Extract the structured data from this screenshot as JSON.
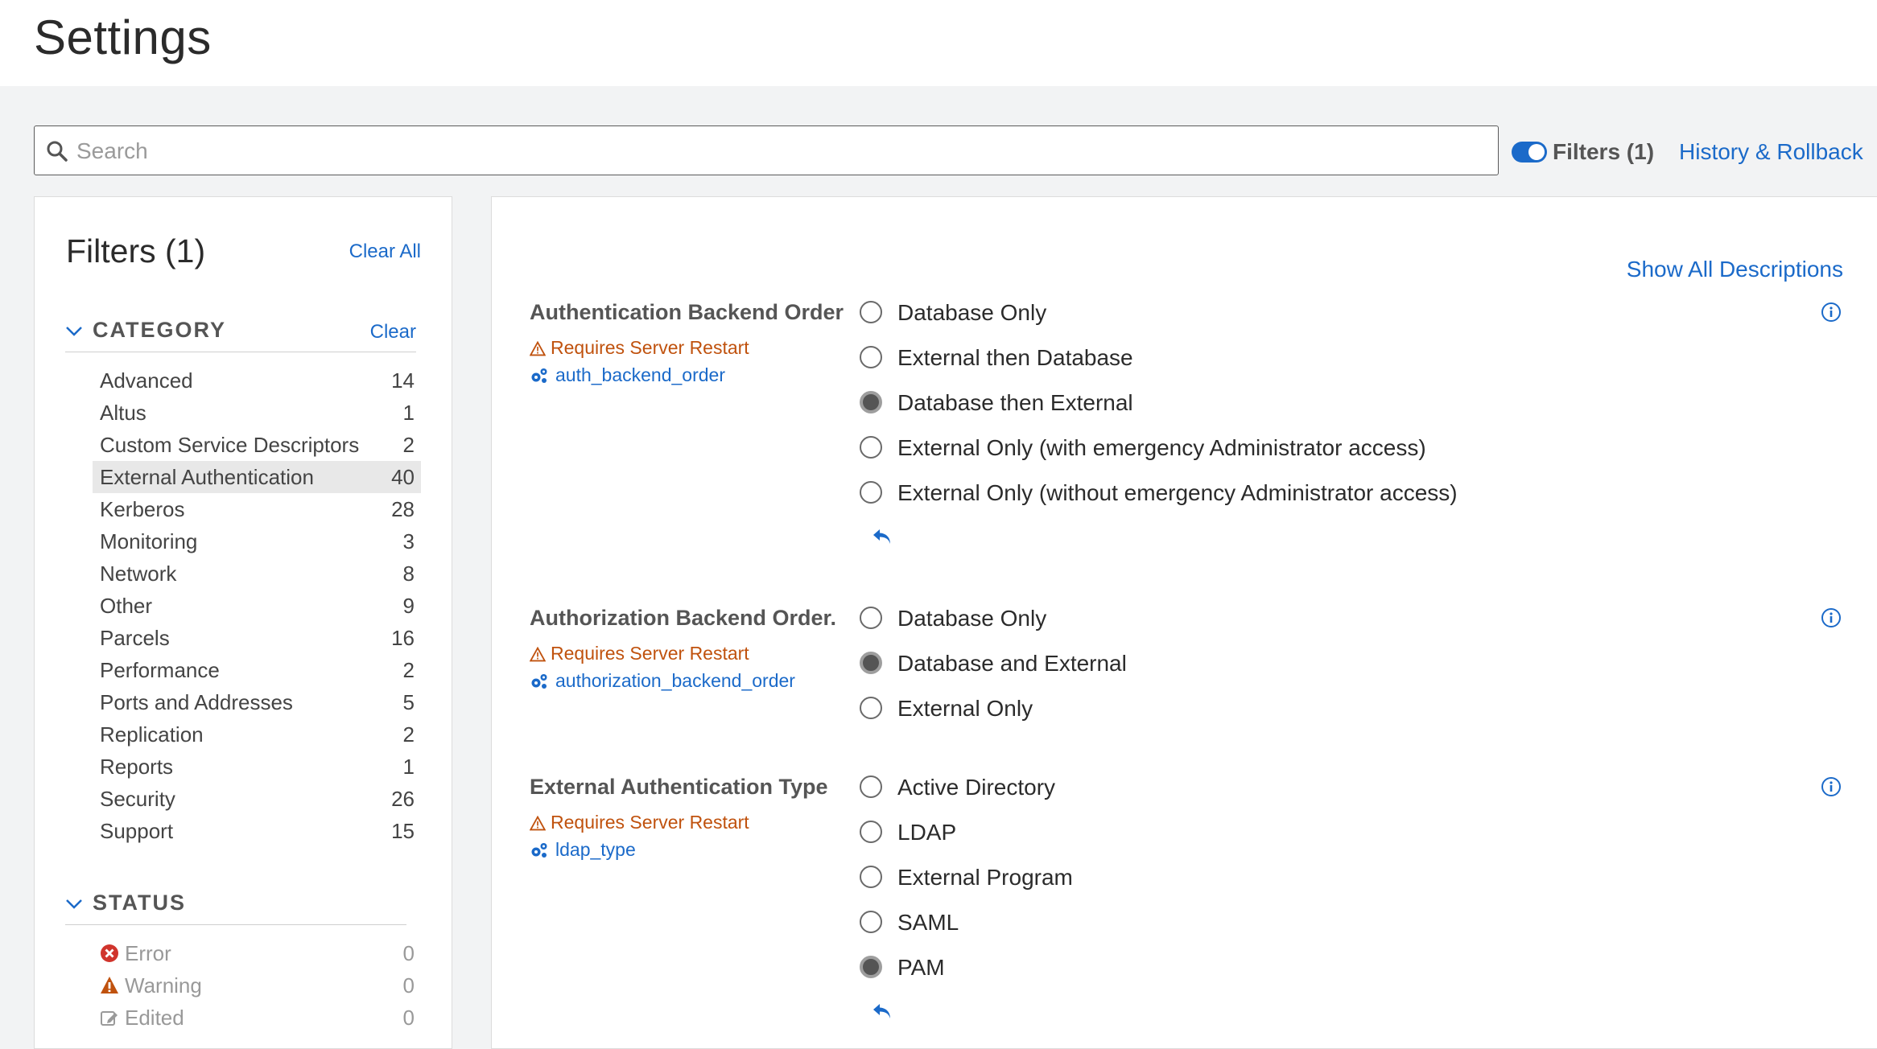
{
  "header": {
    "title": "Settings"
  },
  "toolbar": {
    "search_placeholder": "Search",
    "filters_toggle_label": "Filters (1)",
    "history_link": "History & Rollback"
  },
  "sidebar": {
    "title": "Filters (1)",
    "clear_all": "Clear All",
    "category": {
      "title": "CATEGORY",
      "clear": "Clear",
      "items": [
        {
          "label": "Advanced",
          "count": "14"
        },
        {
          "label": "Altus",
          "count": "1"
        },
        {
          "label": "Custom Service Descriptors",
          "count": "2"
        },
        {
          "label": "External Authentication",
          "count": "40",
          "selected": true
        },
        {
          "label": "Kerberos",
          "count": "28"
        },
        {
          "label": "Monitoring",
          "count": "3"
        },
        {
          "label": "Network",
          "count": "8"
        },
        {
          "label": "Other",
          "count": "9"
        },
        {
          "label": "Parcels",
          "count": "16"
        },
        {
          "label": "Performance",
          "count": "2"
        },
        {
          "label": "Ports and Addresses",
          "count": "5"
        },
        {
          "label": "Replication",
          "count": "2"
        },
        {
          "label": "Reports",
          "count": "1"
        },
        {
          "label": "Security",
          "count": "26"
        },
        {
          "label": "Support",
          "count": "15"
        }
      ]
    },
    "status": {
      "title": "STATUS",
      "items": [
        {
          "label": "Error",
          "count": "0",
          "icon": "error-icon"
        },
        {
          "label": "Warning",
          "count": "0",
          "icon": "warning-icon"
        },
        {
          "label": "Edited",
          "count": "0",
          "icon": "edit-icon"
        }
      ]
    }
  },
  "main": {
    "show_all_descriptions": "Show All Descriptions",
    "restart_label": "Requires Server Restart",
    "settings": [
      {
        "name": "Authentication Backend Order",
        "key": "auth_backend_order",
        "options": [
          "Database Only",
          "External then Database",
          "Database then External",
          "External Only (with emergency Administrator access)",
          "External Only (without emergency Administrator access)"
        ],
        "selected": "Database then External"
      },
      {
        "name": "Authorization Backend Order.",
        "key": "authorization_backend_order",
        "options": [
          "Database Only",
          "Database and External",
          "External Only"
        ],
        "selected": "Database and External"
      },
      {
        "name": "External Authentication Type",
        "key": "ldap_type",
        "options": [
          "Active Directory",
          "LDAP",
          "External Program",
          "SAML",
          "PAM"
        ],
        "selected": "PAM"
      }
    ]
  },
  "colors": {
    "accent": "#1b6ac9",
    "warning": "#c0520e",
    "error": "#d0342c"
  }
}
